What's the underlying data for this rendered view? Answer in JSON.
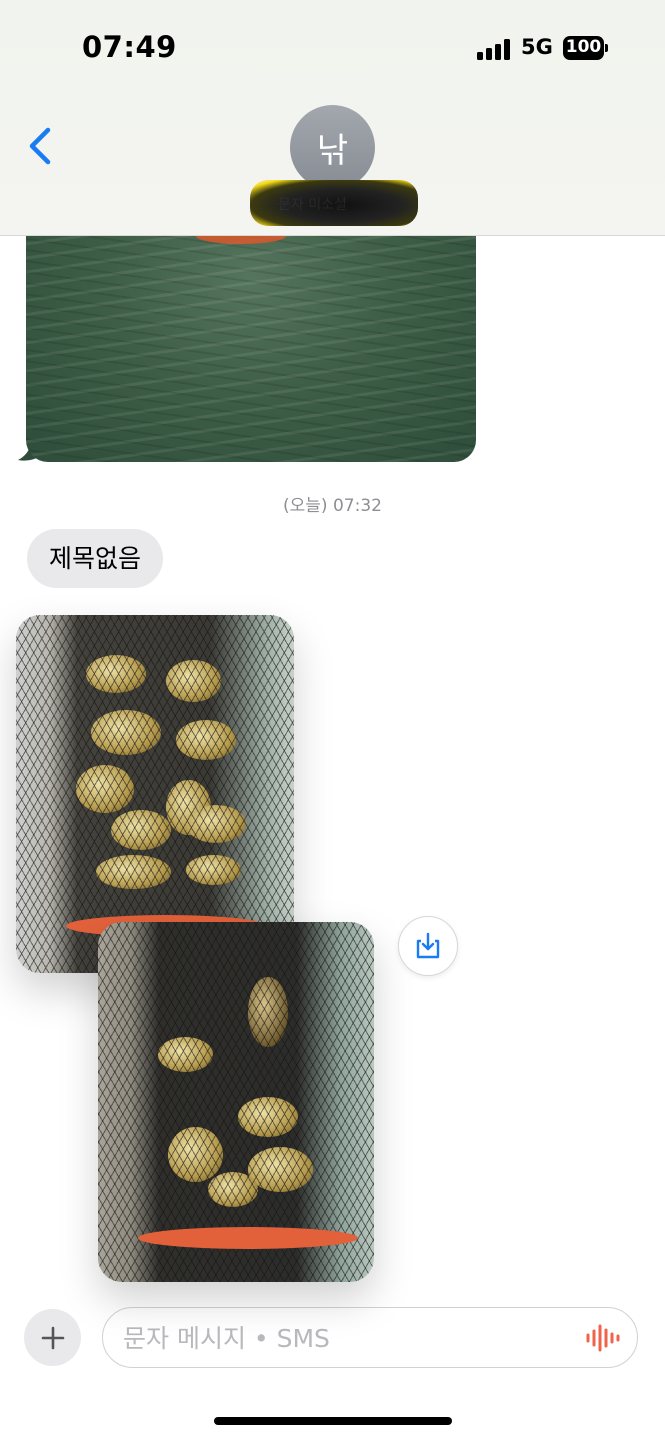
{
  "status_bar": {
    "time": "07:49",
    "network": "5G",
    "battery": "100"
  },
  "header": {
    "back_icon": "chevron-left-icon",
    "avatar_initial": "낚",
    "contact_name": "문자 미소셜",
    "contact_name_redacted": true
  },
  "conversation": {
    "timestamp": "(오늘) 07:32",
    "text_message": "제목없음",
    "save_icon": "download-to-tray-icon"
  },
  "compose": {
    "add_icon": "plus-icon",
    "placeholder": "문자 메시지 • SMS",
    "mic_icon": "waveform-icon"
  },
  "colors": {
    "accent_blue": "#1a7cf4",
    "bubble_gray": "#e9e9eb",
    "mic_red": "#f0624a"
  }
}
